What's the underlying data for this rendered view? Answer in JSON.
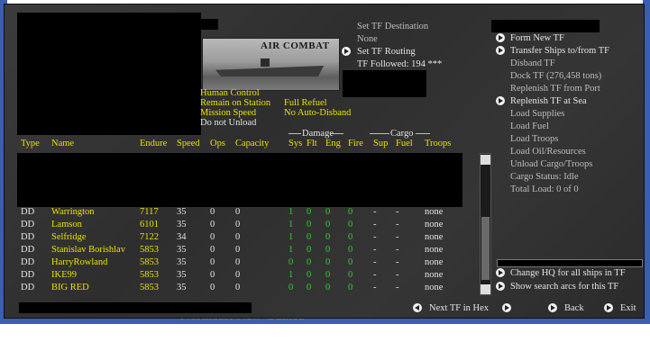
{
  "image_card": {
    "caption": "AIR COMBAT"
  },
  "tf_menu": {
    "set_destination": "Set TF Destination",
    "destination_value": "None",
    "set_routing": "Set TF Routing",
    "followed": "TF Followed: 194 ***"
  },
  "right_menu": [
    {
      "label": "Form New TF",
      "arrow": true,
      "active": true
    },
    {
      "label": "Transfer Ships to/from TF",
      "arrow": true,
      "active": true
    },
    {
      "label": "Disband TF",
      "arrow": false,
      "active": false
    },
    {
      "label": "Dock TF (276,458 tons)",
      "arrow": false,
      "active": false
    },
    {
      "label": "Replenish TF from Port",
      "arrow": false,
      "active": false
    },
    {
      "label": "Replenish TF at Sea",
      "arrow": true,
      "active": true
    },
    {
      "label": "Load Supplies",
      "arrow": false,
      "active": false
    },
    {
      "label": "Load Fuel",
      "arrow": false,
      "active": false
    },
    {
      "label": "Load Troops",
      "arrow": false,
      "active": false
    },
    {
      "label": "Load Oil/Resources",
      "arrow": false,
      "active": false
    },
    {
      "label": "Unload Cargo/Troops",
      "arrow": false,
      "active": false
    },
    {
      "label": "Cargo Status: Idle",
      "arrow": false,
      "active": false
    },
    {
      "label": "Total Load: 0 of 0",
      "arrow": false,
      "active": false
    }
  ],
  "settings": {
    "left": [
      "Human Control",
      "Remain on Station",
      "Mission Speed",
      "Do not Unload"
    ],
    "right": [
      "Full Refuel",
      "No Auto-Disband"
    ]
  },
  "table": {
    "group_damage": "Damage",
    "group_cargo": "Cargo",
    "headers": [
      "Type",
      "Name",
      "Endure",
      "Speed",
      "Ops",
      "Capacity",
      "Sys",
      "Flt",
      "Eng",
      "Fire",
      "Sup",
      "Fuel",
      "Troops"
    ],
    "rows": [
      {
        "type": "DD",
        "name": "Warrington",
        "endure": "7117",
        "speed": "35",
        "ops": "0",
        "capacity": "0",
        "sys": "1",
        "flt": "0",
        "eng": "0",
        "fire": "0",
        "sup": "-",
        "fuel": "-",
        "troops": "none"
      },
      {
        "type": "DD",
        "name": "Lamson",
        "endure": "6101",
        "speed": "35",
        "ops": "0",
        "capacity": "0",
        "sys": "1",
        "flt": "0",
        "eng": "0",
        "fire": "0",
        "sup": "-",
        "fuel": "-",
        "troops": "none"
      },
      {
        "type": "DD",
        "name": "Selfridge",
        "endure": "7122",
        "speed": "34",
        "ops": "0",
        "capacity": "0",
        "sys": "1",
        "flt": "0",
        "eng": "0",
        "fire": "0",
        "sup": "-",
        "fuel": "-",
        "troops": "none"
      },
      {
        "type": "DD",
        "name": "Stanislav Borishlav",
        "endure": "5853",
        "speed": "35",
        "ops": "0",
        "capacity": "0",
        "sys": "1",
        "flt": "0",
        "eng": "0",
        "fire": "0",
        "sup": "-",
        "fuel": "-",
        "troops": "none"
      },
      {
        "type": "DD",
        "name": "HarryRowland",
        "endure": "5853",
        "speed": "35",
        "ops": "0",
        "capacity": "0",
        "sys": "0",
        "flt": "0",
        "eng": "0",
        "fire": "0",
        "sup": "-",
        "fuel": "-",
        "troops": "none"
      },
      {
        "type": "DD",
        "name": "IKE99",
        "endure": "5853",
        "speed": "35",
        "ops": "0",
        "capacity": "0",
        "sys": "1",
        "flt": "0",
        "eng": "0",
        "fire": "0",
        "sup": "-",
        "fuel": "-",
        "troops": "none"
      },
      {
        "type": "DD",
        "name": "BIG RED",
        "endure": "5853",
        "speed": "35",
        "ops": "0",
        "capacity": "0",
        "sys": "0",
        "flt": "0",
        "eng": "0",
        "fire": "0",
        "sup": "-",
        "fuel": "-",
        "troops": "none"
      }
    ]
  },
  "bottom_actions": {
    "change_hq": "Change HQ for all ships in TF",
    "show_search": "Show search arcs for this TF"
  },
  "footer": {
    "next_tf": "Next TF in Hex",
    "back": "Back",
    "exit": "Exit"
  },
  "map_text": "Northeast New Guinea",
  "colors": {
    "panel": "#333333",
    "highlight_text": "#e8e000",
    "damage_text": "#2fd02f",
    "map_water": "#3a5fb0"
  }
}
